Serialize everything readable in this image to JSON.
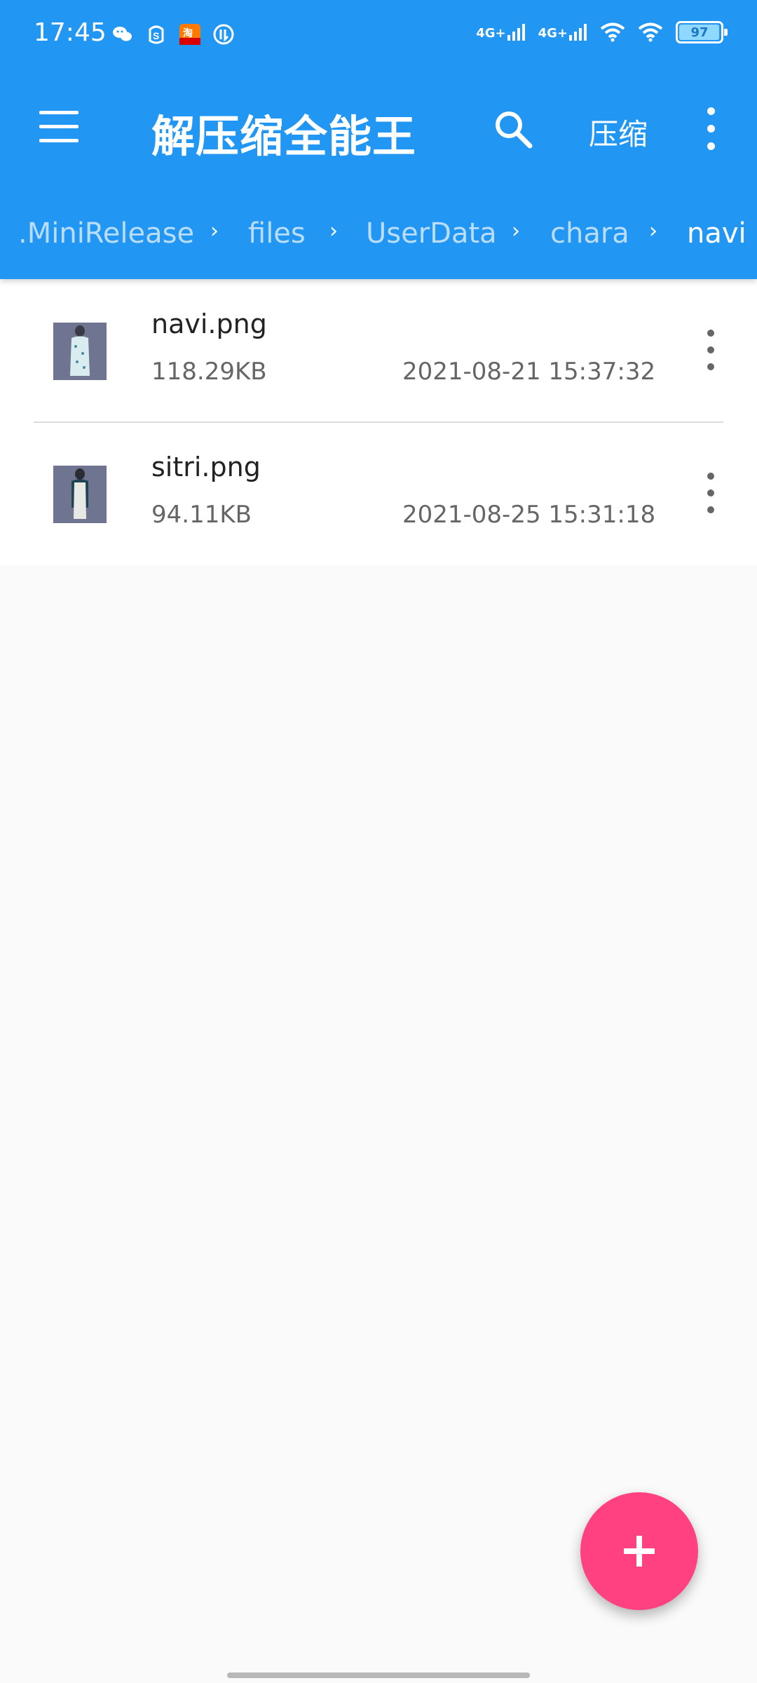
{
  "status_bar": {
    "time": "17:45",
    "notification_icons": [
      "wechat-icon",
      "weibo-icon",
      "taobao-icon",
      "app-icon"
    ],
    "network_labels": [
      "4G+",
      "4G+"
    ],
    "battery": "97"
  },
  "toolbar": {
    "title": "解压缩全能王",
    "compress_label": "压缩"
  },
  "breadcrumb": {
    "items": [
      ".MiniRelease",
      "files",
      "UserData",
      "chara",
      "navi"
    ]
  },
  "files": [
    {
      "name": "navi.png",
      "size": "118.29KB",
      "date": "2021-08-21 15:37:32"
    },
    {
      "name": "sitri.png",
      "size": "94.11KB",
      "date": "2021-08-25 15:31:18"
    }
  ],
  "colors": {
    "primary": "#2296f3",
    "accent": "#ff4081"
  }
}
